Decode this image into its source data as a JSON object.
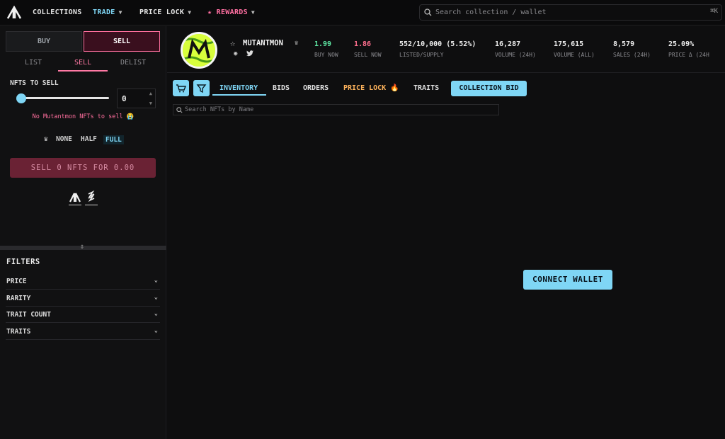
{
  "nav": {
    "collections": "COLLECTIONS",
    "trade": "TRADE",
    "price_lock": "PRICE LOCK",
    "rewards": "REWARDS",
    "search_placeholder": "Search collection / wallet",
    "search_shortcut": "⌘K"
  },
  "side": {
    "buy": "BUY",
    "sell": "SELL",
    "tabs": [
      "LIST",
      "SELL",
      "DELIST"
    ],
    "nfts_to_sell_label": "NFTS TO SELL",
    "nfts_to_sell_value": "0",
    "empty_message": "No Mutantmon NFTs to sell 😭",
    "sweep": {
      "none": "NONE",
      "half": "HALF",
      "full": "FULL"
    },
    "sell_button": "SELL 0 NFTS FOR 0.00",
    "filters_title": "FILTERS",
    "filters": [
      "PRICE",
      "RARITY",
      "TRAIT COUNT",
      "TRAITS"
    ]
  },
  "collection": {
    "name": "MUTANTMON",
    "stats": [
      {
        "value": "1.99",
        "label": "BUY NOW"
      },
      {
        "value": "1.86",
        "label": "SELL NOW"
      },
      {
        "value": "552/10,000 (5.52%)",
        "label": "LISTED/SUPPLY"
      },
      {
        "value": "16,287",
        "label": "VOLUME (24H)"
      },
      {
        "value": "175,615",
        "label": "VOLUME (ALL)"
      },
      {
        "value": "8,579",
        "label": "SALES (24H)"
      },
      {
        "value": "25.09%",
        "label": "PRICE Δ (24H"
      }
    ]
  },
  "toolbar": {
    "tabs": [
      "INVENTORY",
      "BIDS",
      "ORDERS",
      "PRICE LOCK 🔥",
      "TRAITS"
    ],
    "collection_bid": "COLLECTION BID",
    "nft_search_placeholder": "Search NFTs by Name"
  },
  "main": {
    "connect_wallet": "CONNECT WALLET"
  },
  "colors": {
    "accent": "#7fd6f5",
    "pink": "#ff6f9e",
    "green": "#5ee7a3",
    "orange": "#ffb45c"
  }
}
